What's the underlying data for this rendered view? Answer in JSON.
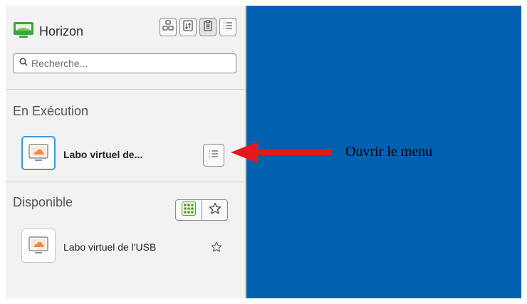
{
  "app": {
    "title": "Horizon"
  },
  "search": {
    "placeholder": "Recherche..."
  },
  "sections": {
    "running": {
      "title": "En Exécution",
      "items": [
        {
          "name": "Labo virtuel de..."
        }
      ]
    },
    "available": {
      "title": "Disponible",
      "items": [
        {
          "name": "Labo virtuel de l'USB"
        }
      ]
    }
  },
  "annotation": {
    "text": "Ouvrir le menu"
  },
  "icons": {
    "logo": "horizon-logo-icon",
    "toolbar": [
      "grid-view-icon",
      "transfer-icon",
      "clipboard-icon",
      "list-icon"
    ],
    "search": "search-icon",
    "machine": "desktop-pool-icon",
    "menu": "menu-list-icon",
    "view_grid": "grid-dots-icon",
    "favorite": "star-icon"
  },
  "colors": {
    "accent": "#3a9bd9",
    "logo_green": "#3fa33a",
    "cloud_orange": "#f0874a",
    "main_background": "#0060b0",
    "callout_red": "#e8171e",
    "grid_dots_green": "#5d9c2c"
  }
}
